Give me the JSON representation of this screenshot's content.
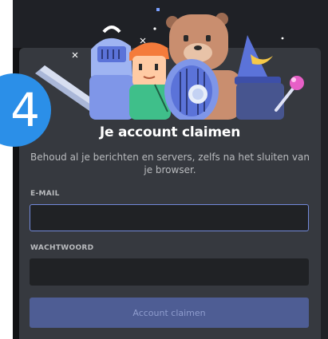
{
  "step_badge": "4",
  "dialog": {
    "title": "Je account claimen",
    "subtitle": "Behoud al je berichten en servers, zelfs na het sluiten van je browser.",
    "email_label": "E-MAIL",
    "email_value": "",
    "password_label": "WACHTWOORD",
    "password_value": "",
    "submit_label": "Account claimen"
  },
  "colors": {
    "modal_background": "#36393f",
    "input_background": "#202225",
    "input_focus_border": "#7289da",
    "button_disabled": "#4e5d94",
    "badge": "#2b8fe8"
  },
  "illustration": {
    "characters": [
      "knight-icon",
      "redhead-icon",
      "bear-icon",
      "wizard-hat-icon",
      "magic-wand-icon",
      "sword-icon",
      "shield-icon"
    ]
  }
}
